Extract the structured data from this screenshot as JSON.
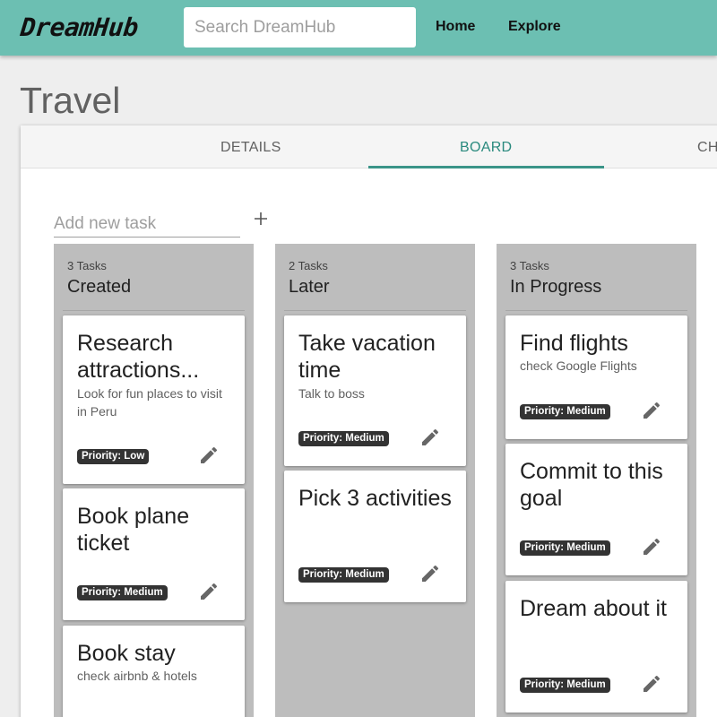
{
  "header": {
    "logo": "DreamHub",
    "search_placeholder": "Search DreamHub",
    "nav": [
      "Home",
      "Explore"
    ]
  },
  "page": {
    "title": "Travel",
    "tabs": [
      "DETAILS",
      "BOARD",
      "CH"
    ],
    "active_tab": "BOARD",
    "add_task_placeholder": "Add new task",
    "add_task_icon": "plus-icon"
  },
  "colors": {
    "topbar": "#6cbfb2",
    "accent": "#2a8a7e",
    "column_bg": "#bdbdbd",
    "badge_bg": "#333333"
  },
  "columns": [
    {
      "count": "3 Tasks",
      "title": "Created",
      "cards": [
        {
          "title": "Research attractions...",
          "description": "Look for fun places to visit in Peru",
          "priority": "Priority: Low"
        },
        {
          "title": "Book plane ticket",
          "description": "",
          "priority": "Priority: Medium"
        },
        {
          "title": "Book stay",
          "description": "check airbnb & hotels",
          "priority": ""
        }
      ]
    },
    {
      "count": "2 Tasks",
      "title": "Later",
      "cards": [
        {
          "title": "Take vacation time",
          "description": "Talk to boss",
          "priority": "Priority: Medium"
        },
        {
          "title": "Pick 3 activities",
          "description": "",
          "priority": "Priority: Medium"
        }
      ]
    },
    {
      "count": "3 Tasks",
      "title": "In Progress",
      "cards": [
        {
          "title": "Find flights",
          "description": "check Google Flights",
          "priority": "Priority: Medium"
        },
        {
          "title": "Commit to this goal",
          "description": "",
          "priority": "Priority: Medium"
        },
        {
          "title": "Dream about it",
          "description": "",
          "priority": "Priority: Medium"
        }
      ]
    }
  ],
  "card_edit_icon": "pencil-icon"
}
